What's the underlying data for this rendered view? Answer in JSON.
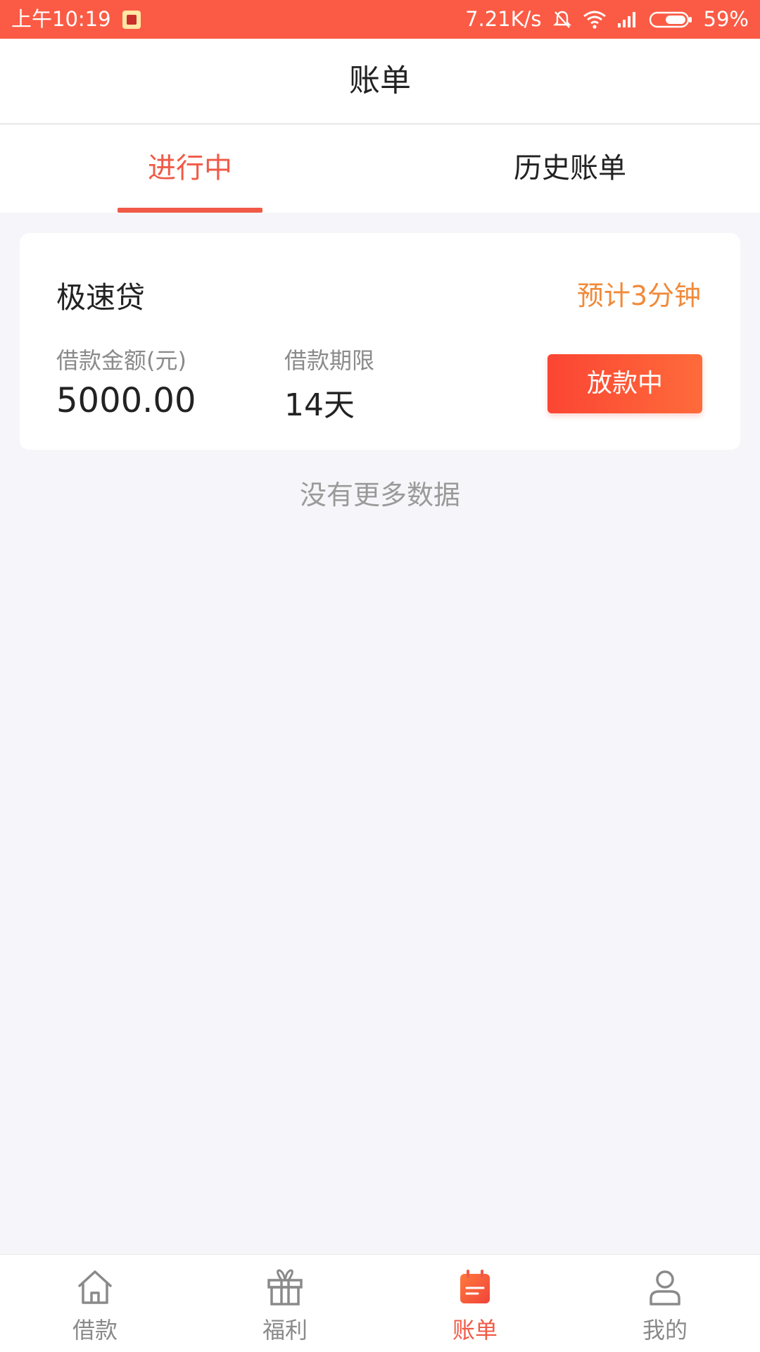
{
  "status_bar": {
    "time": "上午10:19",
    "network_speed": "7.21K/s",
    "battery": "59%"
  },
  "header": {
    "title": "账单"
  },
  "tabs": [
    {
      "label": "进行中",
      "active": true
    },
    {
      "label": "历史账单",
      "active": false
    }
  ],
  "card": {
    "title": "极速贷",
    "eta": "预计3分钟",
    "amount_label": "借款金额(元)",
    "amount_value": "5000.00",
    "term_label": "借款期限",
    "term_value": "14天",
    "status_button": "放款中"
  },
  "empty_hint": "没有更多数据",
  "bottom_nav": [
    {
      "label": "借款",
      "icon": "home-icon",
      "active": false
    },
    {
      "label": "福利",
      "icon": "gift-icon",
      "active": false
    },
    {
      "label": "账单",
      "icon": "bill-icon",
      "active": true
    },
    {
      "label": "我的",
      "icon": "user-icon",
      "active": false
    }
  ],
  "colors": {
    "brand": "#f05a47",
    "status_bar": "#fb5b45",
    "eta": "#f08a3a",
    "background": "#f6f6fa"
  }
}
